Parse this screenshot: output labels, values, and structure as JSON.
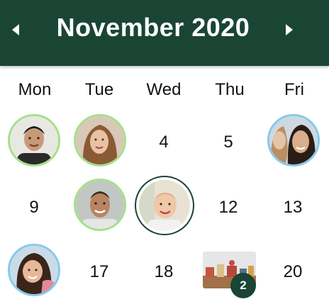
{
  "header": {
    "title": "November 2020",
    "prev_icon": "chevron-left-icon",
    "next_icon": "chevron-right-icon",
    "background": "#1a4535"
  },
  "weekdays": [
    "Mon",
    "Tue",
    "Wed",
    "Thu",
    "Fri"
  ],
  "days": {
    "d4": "4",
    "d5": "5",
    "d9": "9",
    "d12": "12",
    "d13": "13",
    "d17": "17",
    "d18": "18",
    "d20": "20"
  },
  "photo_day": {
    "count": "2"
  },
  "colors": {
    "ring_green": "#a6e08a",
    "ring_blue": "#86c9ec",
    "ring_selected": "#1a4535"
  }
}
